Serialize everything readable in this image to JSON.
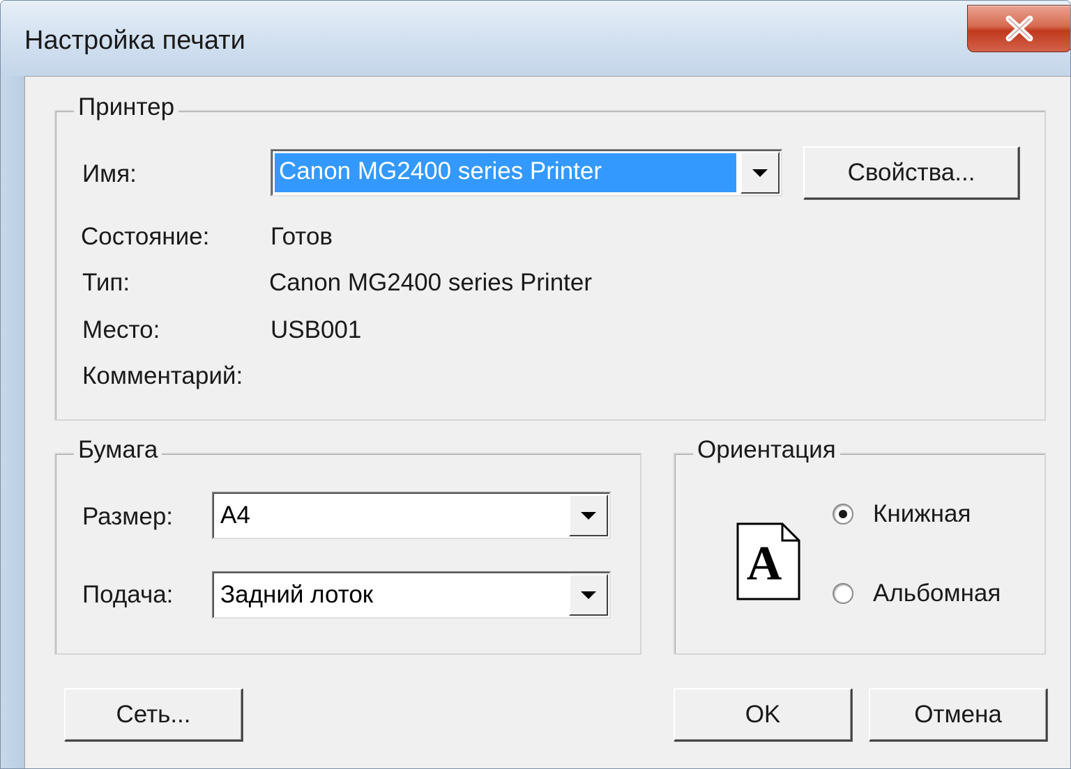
{
  "window": {
    "title": "Настройка печати"
  },
  "printer": {
    "group_label": "Принтер",
    "name_label": "Имя:",
    "name_value": "Canon MG2400 series Printer",
    "properties_button": "Свойства...",
    "status_label": "Состояние:",
    "status_value": "Готов",
    "type_label": "Тип:",
    "type_value": "Canon MG2400 series Printer",
    "location_label": "Место:",
    "location_value": "USB001",
    "comment_label": "Комментарий:"
  },
  "paper": {
    "group_label": "Бумага",
    "size_label": "Размер:",
    "size_value": "A4",
    "source_label": "Подача:",
    "source_value": "Задний лоток"
  },
  "orientation": {
    "group_label": "Ориентация",
    "page_glyph": "A",
    "portrait_label": "Книжная",
    "landscape_label": "Альбомная",
    "selected": "portrait"
  },
  "buttons": {
    "network": "Сеть...",
    "ok": "OK",
    "cancel": "Отмена"
  },
  "colors": {
    "selection": "#3399ff",
    "close_button": "#c0391d",
    "dialog_bg": "#f0f0f0"
  },
  "icons": {
    "close": "close-icon",
    "dropdown": "chevron-down-icon",
    "page": "portrait-page-icon"
  }
}
